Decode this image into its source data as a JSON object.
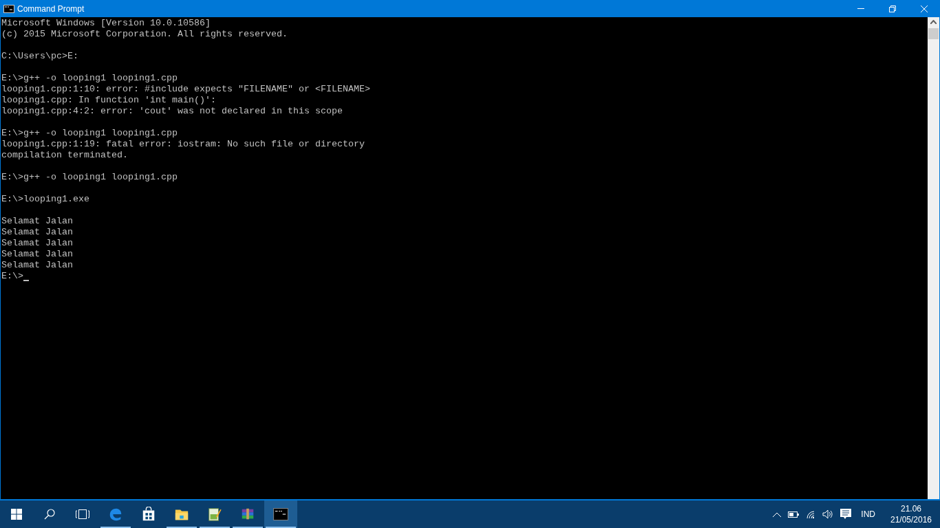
{
  "window": {
    "title": "Command Prompt"
  },
  "console": {
    "blocks": [
      [
        "Microsoft Windows [Version 10.0.10586]",
        "(c) 2015 Microsoft Corporation. All rights reserved."
      ],
      [
        "C:\\Users\\pc>E:"
      ],
      [
        "E:\\>g++ -o looping1 looping1.cpp",
        "looping1.cpp:1:10: error: #include expects \"FILENAME\" or <FILENAME>",
        "looping1.cpp: In function 'int main()':",
        "looping1.cpp:4:2: error: 'cout' was not declared in this scope"
      ],
      [
        "E:\\>g++ -o looping1 looping1.cpp",
        "looping1.cpp:1:19: fatal error: iostram: No such file or directory",
        "compilation terminated."
      ],
      [
        "E:\\>g++ -o looping1 looping1.cpp"
      ],
      [
        "E:\\>looping1.exe"
      ],
      [
        "Selamat Jalan",
        "Selamat Jalan",
        "Selamat Jalan",
        "Selamat Jalan",
        "Selamat Jalan",
        "E:\\>"
      ]
    ],
    "cursor": true
  },
  "taskbar": {
    "apps": [
      {
        "kind": "edge",
        "running": true,
        "selected": false
      },
      {
        "kind": "store",
        "running": false,
        "selected": false
      },
      {
        "kind": "explorer",
        "running": true,
        "selected": false
      },
      {
        "kind": "notepad",
        "running": true,
        "selected": false
      },
      {
        "kind": "archive",
        "running": true,
        "selected": false
      },
      {
        "kind": "console",
        "running": true,
        "selected": true
      }
    ],
    "language": "IND",
    "time": "21.06",
    "date": "21/05/2016"
  }
}
